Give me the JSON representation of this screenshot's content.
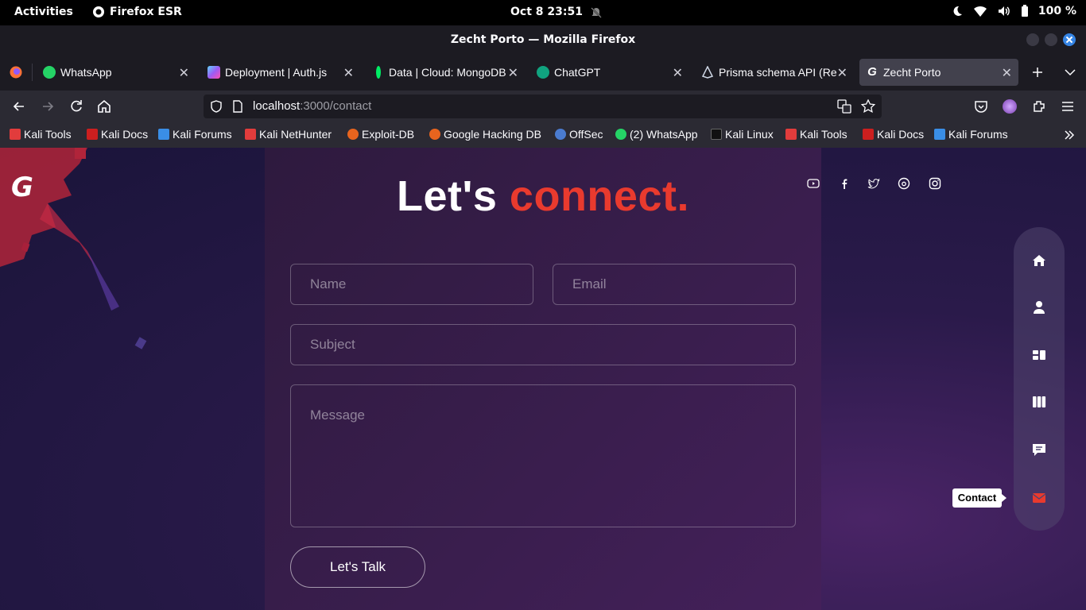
{
  "system_bar": {
    "activities": "Activities",
    "app_name": "Firefox ESR",
    "clock": "Oct 8  23:51",
    "battery": "100 %"
  },
  "window": {
    "title": "Zecht Porto — Mozilla Firefox"
  },
  "tabs": [
    {
      "label": "WhatsApp",
      "icon": "whatsapp-icon",
      "color": "#25d366"
    },
    {
      "label": "Deployment | Auth.js",
      "icon": "authjs-icon",
      "color": "#9b5cf6"
    },
    {
      "label": "Data | Cloud: MongoDB",
      "icon": "mongodb-icon",
      "color": "#00ed64"
    },
    {
      "label": "ChatGPT",
      "icon": "chatgpt-icon",
      "color": "#10a37f"
    },
    {
      "label": "Prisma schema API (Re",
      "icon": "prisma-icon",
      "color": "#cfd8e6"
    },
    {
      "label": "Zecht Porto",
      "icon": "zecht-icon",
      "color": "#ffffff"
    }
  ],
  "urlbar": {
    "host": "localhost",
    "rest": ":3000/contact"
  },
  "bookmarks": [
    {
      "label": "Kali Tools",
      "color": "#e23c3c"
    },
    {
      "label": "Kali Docs",
      "color": "#cc1f1f"
    },
    {
      "label": "Kali Forums",
      "color": "#3a8ee6"
    },
    {
      "label": "Kali NetHunter",
      "color": "#e23c3c"
    },
    {
      "label": "Exploit-DB",
      "color": "#e8641e"
    },
    {
      "label": "Google Hacking DB",
      "color": "#e8641e"
    },
    {
      "label": "OffSec",
      "color": "#4a7bd0"
    },
    {
      "label": "(2) WhatsApp",
      "color": "#25d366"
    },
    {
      "label": "Kali Linux",
      "color": "#111111"
    },
    {
      "label": "Kali Tools",
      "color": "#e23c3c"
    },
    {
      "label": "Kali Docs",
      "color": "#cc1f1f"
    },
    {
      "label": "Kali Forums",
      "color": "#3a8ee6"
    }
  ],
  "page": {
    "logo": "G",
    "headline_part1": "Let's ",
    "headline_part2": "connect.",
    "accent_color": "#e93a2e",
    "form": {
      "name_placeholder": "Name",
      "email_placeholder": "Email",
      "subject_placeholder": "Subject",
      "message_placeholder": "Message",
      "submit_label": "Let's Talk"
    },
    "socials": [
      "youtube-icon",
      "facebook-icon",
      "twitter-icon",
      "threads-icon",
      "instagram-icon"
    ],
    "side_nav": {
      "items": [
        "home-icon",
        "user-icon",
        "services-icon",
        "work-icon",
        "testimonials-icon",
        "mail-icon"
      ],
      "active": "mail-icon",
      "tooltip": "Contact"
    }
  }
}
